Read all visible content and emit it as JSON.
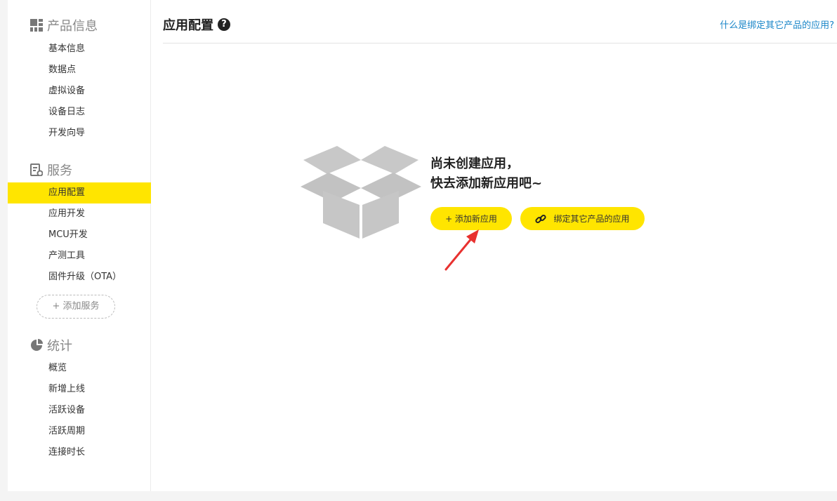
{
  "sidebar": {
    "sections": [
      {
        "title": "产品信息",
        "icon": "grid-icon",
        "items": [
          {
            "label": "基本信息"
          },
          {
            "label": "数据点"
          },
          {
            "label": "虚拟设备"
          },
          {
            "label": "设备日志"
          },
          {
            "label": "开发向导"
          }
        ]
      },
      {
        "title": "服务",
        "icon": "service-icon",
        "items": [
          {
            "label": "应用配置",
            "active": true
          },
          {
            "label": "应用开发"
          },
          {
            "label": "MCU开发"
          },
          {
            "label": "产测工具"
          },
          {
            "label": "固件升级（OTA）"
          }
        ],
        "add_label": "+ 添加服务"
      },
      {
        "title": "统计",
        "icon": "pie-chart-icon",
        "items": [
          {
            "label": "概览"
          },
          {
            "label": "新增上线"
          },
          {
            "label": "活跃设备"
          },
          {
            "label": "活跃周期"
          },
          {
            "label": "连接时长"
          }
        ]
      }
    ]
  },
  "main": {
    "title": "应用配置",
    "help_link": "什么是绑定其它产品的应用?",
    "empty": {
      "line1": "尚未创建应用，",
      "line2": "快去添加新应用吧~",
      "add_button": "+ 添加新应用",
      "bind_button": "绑定其它产品的应用"
    }
  },
  "colors": {
    "accent": "#ffe500",
    "link": "#1a86c8",
    "annotation_arrow": "#e8312f"
  }
}
